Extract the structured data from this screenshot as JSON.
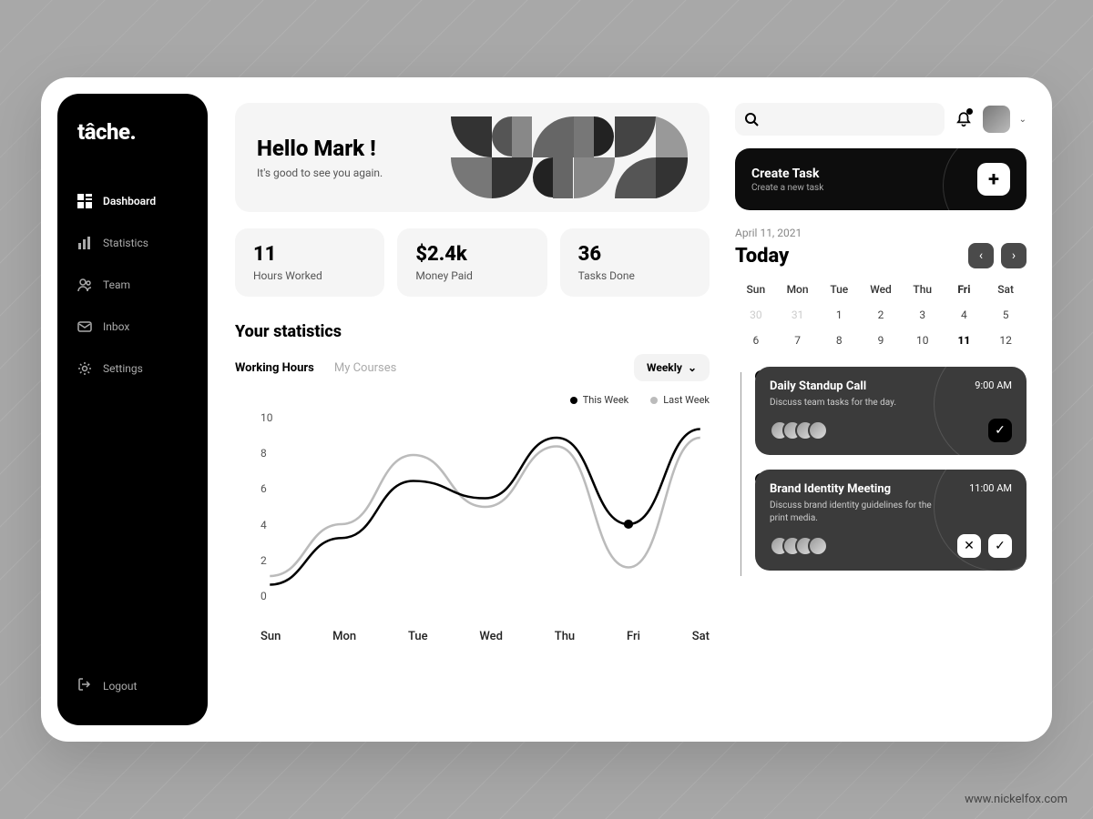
{
  "brand": {
    "logo_text": "tâche."
  },
  "sidebar": {
    "items": [
      {
        "label": "Dashboard",
        "icon": "grid-icon",
        "active": true
      },
      {
        "label": "Statistics",
        "icon": "chart-icon"
      },
      {
        "label": "Team",
        "icon": "users-icon"
      },
      {
        "label": "Inbox",
        "icon": "mail-icon"
      },
      {
        "label": "Settings",
        "icon": "gear-icon"
      }
    ],
    "logout_label": "Logout"
  },
  "hero": {
    "greeting": "Hello Mark  !",
    "sub": "It's good to see you again."
  },
  "stat_cards": [
    {
      "value": "11",
      "label": "Hours Worked"
    },
    {
      "value": "$2.4k",
      "label": "Money Paid"
    },
    {
      "value": "36",
      "label": "Tasks Done"
    }
  ],
  "stats_section": {
    "title": "Your statistics",
    "tabs": [
      {
        "label": "Working Hours",
        "active": true
      },
      {
        "label": "My Courses"
      }
    ],
    "period_label": "Weekly",
    "legend": [
      {
        "label": "This Week",
        "variant": "dark"
      },
      {
        "label": "Last Week",
        "variant": "light"
      }
    ]
  },
  "chart_data": {
    "type": "line",
    "xlabel": "",
    "ylabel": "",
    "ylim": [
      0,
      10
    ],
    "y_ticks": [
      10,
      8,
      6,
      4,
      2,
      0
    ],
    "categories": [
      "Sun",
      "Mon",
      "Tue",
      "Wed",
      "Thu",
      "Fri",
      "Sat"
    ],
    "series": [
      {
        "name": "This Week",
        "color": "#000000",
        "values": [
          0.5,
          3.2,
          6.5,
          5.5,
          9.0,
          4.0,
          9.5
        ]
      },
      {
        "name": "Last Week",
        "color": "#bbbbbb",
        "values": [
          1.0,
          4.0,
          8.0,
          5.0,
          8.5,
          1.5,
          9.0
        ]
      }
    ],
    "highlight_point": {
      "series": "This Week",
      "category": "Fri",
      "value": 4.0
    }
  },
  "search": {
    "placeholder": ""
  },
  "create_task": {
    "title": "Create  Task",
    "sub": "Create a new task"
  },
  "calendar": {
    "date_label": "April 11, 2021",
    "heading": "Today",
    "day_headers": [
      "Sun",
      "Mon",
      "Tue",
      "Wed",
      "Thu",
      "Fri",
      "Sat"
    ],
    "today_header_index": 5,
    "rows": [
      [
        {
          "n": "30",
          "dim": true
        },
        {
          "n": "31",
          "dim": true
        },
        {
          "n": "1"
        },
        {
          "n": "2"
        },
        {
          "n": "3"
        },
        {
          "n": "4"
        },
        {
          "n": "5"
        }
      ],
      [
        {
          "n": "6"
        },
        {
          "n": "7"
        },
        {
          "n": "8"
        },
        {
          "n": "9"
        },
        {
          "n": "10"
        },
        {
          "n": "11",
          "today": true
        },
        {
          "n": "12"
        }
      ]
    ]
  },
  "events": [
    {
      "title": "Daily Standup Call",
      "time": "9:00 AM",
      "desc": "Discuss team tasks for the day.",
      "avatars_count": 4,
      "dot_filled": true,
      "actions": [
        "check"
      ]
    },
    {
      "title": "Brand Identity Meeting",
      "time": "11:00 AM",
      "desc": "Discuss brand identity guidelines for the print media.",
      "avatars_count": 4,
      "dot_filled": false,
      "actions": [
        "close",
        "check"
      ]
    }
  ],
  "footer_credit": "www.nickelfox.com"
}
